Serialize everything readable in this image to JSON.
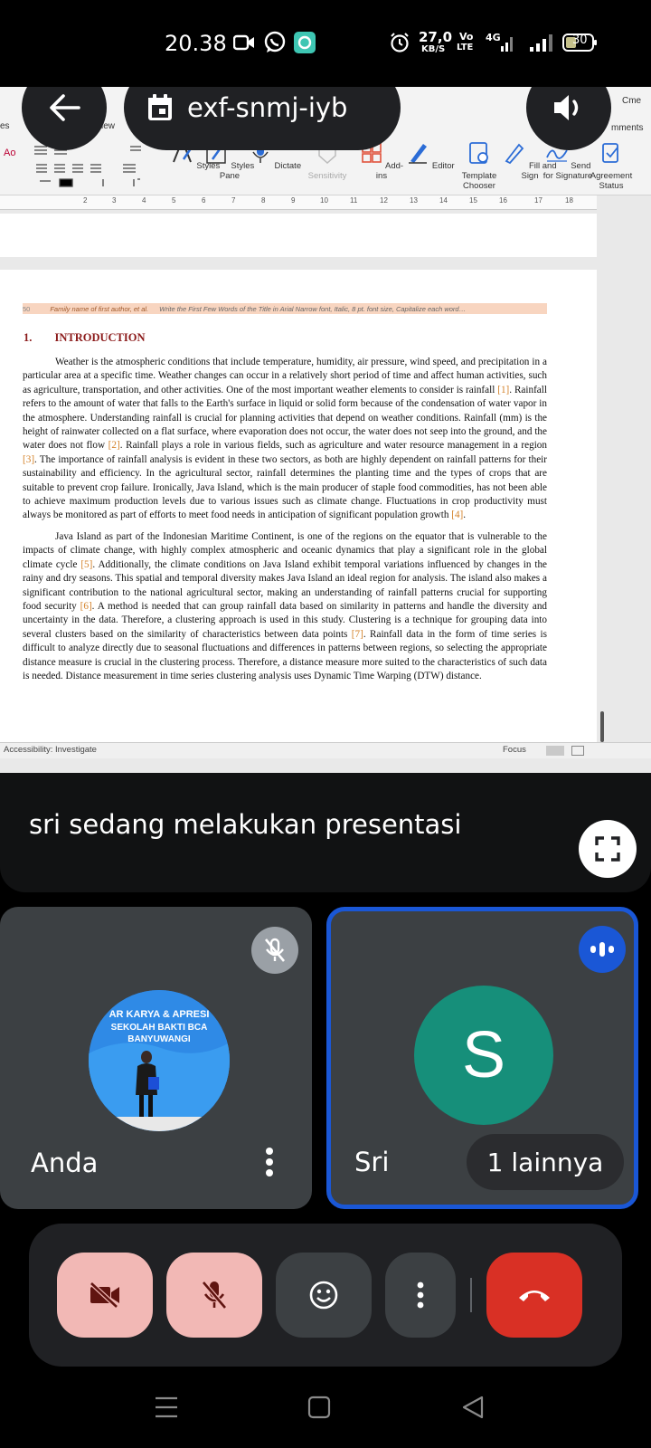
{
  "status_bar": {
    "time": "20.38",
    "speed_value": "27,0",
    "speed_unit": "KB/S",
    "volte": "Vo",
    "lte": "LTE",
    "network": "4G",
    "battery": "30",
    "icons": [
      "video-camera-icon",
      "whatsapp-icon",
      "teal-app-icon",
      "alarm-icon",
      "signal-icon",
      "battery-icon"
    ]
  },
  "call": {
    "back_icon": "arrow-left-icon",
    "calendar_icon": "calendar-icon",
    "meeting_code": "exf-snmj-iyb",
    "speaker_icon": "volume-icon"
  },
  "ribbon": {
    "partial_left_1": "es",
    "partial_left_2": "iew",
    "partial_right_1": "Cme",
    "partial_right_2": "mments",
    "items": [
      {
        "label": "Styles",
        "icon": "styles-icon"
      },
      {
        "label": "Styles Pane",
        "icon": "styles-pane-icon"
      },
      {
        "label": "Dictate",
        "icon": "microphone-icon"
      },
      {
        "label": "Sensitivity",
        "icon": "sensitivity-icon"
      },
      {
        "label": "Add-ins",
        "icon": "grid-icon"
      },
      {
        "label": "Editor",
        "icon": "editor-pen-icon"
      },
      {
        "label": "Template Chooser",
        "icon": "template-icon"
      },
      {
        "label": "Fill and Sign",
        "icon": "fill-sign-icon"
      },
      {
        "label": "Send for Signature",
        "icon": "signature-icon"
      },
      {
        "label": "Agreement Status",
        "icon": "agreement-icon"
      }
    ]
  },
  "ruler": {
    "numbers": [
      "2",
      "3",
      "4",
      "5",
      "6",
      "7",
      "8",
      "9",
      "10",
      "11",
      "12",
      "13",
      "14",
      "15",
      "16",
      "17",
      "18"
    ]
  },
  "document": {
    "page_number": "50",
    "header_author": "Family name of first author, et al.",
    "header_title": "Write the First Few Words of the Title in Arial Narrow font, Italic, 8 pt. font size, Capitalize each word…",
    "section_number": "1.",
    "section_title": "INTRODUCTION",
    "p1_a": "Weather is the atmospheric conditions that include temperature, humidity, air pressure, wind speed, and precipitation in a particular area at a specific time. Weather changes can occur in a relatively short period of time and affect human activities, such as agriculture, transportation, and other activities. One of the most important weather elements to consider is rainfall ",
    "ref1": "[1]",
    "p1_b": ". Rainfall refers to the amount of water that falls to the Earth's surface in liquid or solid form because of the condensation of water vapor in the atmosphere. Understanding rainfall is crucial for planning activities that depend on weather conditions. Rainfall (mm) is the height of rainwater collected on a flat surface, where evaporation does not occur, the water does not seep into the ground, and the water does not flow ",
    "ref2": "[2]",
    "p1_c": ". Rainfall plays a role in various fields, such as agriculture and water resource management in a region ",
    "ref3": "[3]",
    "p1_d": ". The importance of rainfall analysis is evident in these two sectors, as both are highly dependent on rainfall patterns for their sustainability and efficiency. In the agricultural sector, rainfall determines the planting time and the types of crops that are suitable to prevent crop failure. Ironically, Java Island, which is the main producer of staple food commodities, has not been able to achieve maximum production levels due to various issues such as climate change. Fluctuations in crop productivity must always be monitored as part of efforts to meet food needs in anticipation of significant population growth ",
    "ref4": "[4]",
    "p1_e": ".",
    "p2_a": "Java Island as part of the Indonesian Maritime Continent, is one of the regions on the equator that is vulnerable to the impacts of climate change, with highly complex atmospheric and oceanic dynamics that play a significant role in the global climate cycle ",
    "ref5": "[5]",
    "p2_b": ". Additionally, the climate conditions on Java Island exhibit temporal variations influenced by changes in the rainy and dry seasons. This spatial and temporal diversity makes Java Island an ideal region for analysis. The island also makes a significant contribution to the national agricultural sector, making an understanding of rainfall patterns crucial for supporting food security ",
    "ref6": "[6]",
    "p2_c": ". A method is needed that can group rainfall data based on similarity in patterns and handle the diversity and uncertainty in the data. Therefore, a clustering approach is used in this study. Clustering is a technique for grouping data into several clusters based on the similarity of characteristics between data points ",
    "ref7": "[7]",
    "p2_d": ". Rainfall data in the form of time series is difficult to analyze directly due to seasonal fluctuations and differences in patterns between regions, so selecting the appropriate distance measure is crucial in the clustering process. Therefore, a distance measure more suited to the characteristics of such data is needed. Distance measurement in time series clustering analysis uses Dynamic Time Warping (DTW) distance."
  },
  "accessibility_bar": {
    "label": "Accessibility: Investigate",
    "focus": "Focus"
  },
  "presenting": {
    "text": "sri sedang melakukan presentasi",
    "fullscreen_icon": "fullscreen-icon"
  },
  "tiles": {
    "self": {
      "name": "Anda",
      "mic_icon": "mic-off-icon",
      "menu_icon": "more-vert-icon",
      "photo_banner_1": "AR KARYA & APRESI",
      "photo_banner_2": "SEKOLAH BAKTI BCA",
      "photo_banner_3": "BANYUWANGI"
    },
    "other": {
      "name": "Sri",
      "initial": "S",
      "speaking_icon": "audio-level-icon",
      "more_label": "1 lainnya"
    }
  },
  "controls": {
    "camera_icon": "camera-off-icon",
    "mic_icon": "mic-off-icon",
    "emoji_icon": "emoji-icon",
    "more_icon": "more-vert-icon",
    "end_call_icon": "end-call-icon"
  },
  "navbar": {
    "icons": [
      "menu-lines-icon",
      "home-square-icon",
      "back-triangle-icon"
    ]
  },
  "colors": {
    "tile_bg": "#3c4043",
    "control_bar": "#202124",
    "muted_button": "#f2b8b5",
    "end_call": "#d93025",
    "active_border": "#1a57d6",
    "avatar_s": "#168f7a",
    "citation": "#d4822a"
  }
}
